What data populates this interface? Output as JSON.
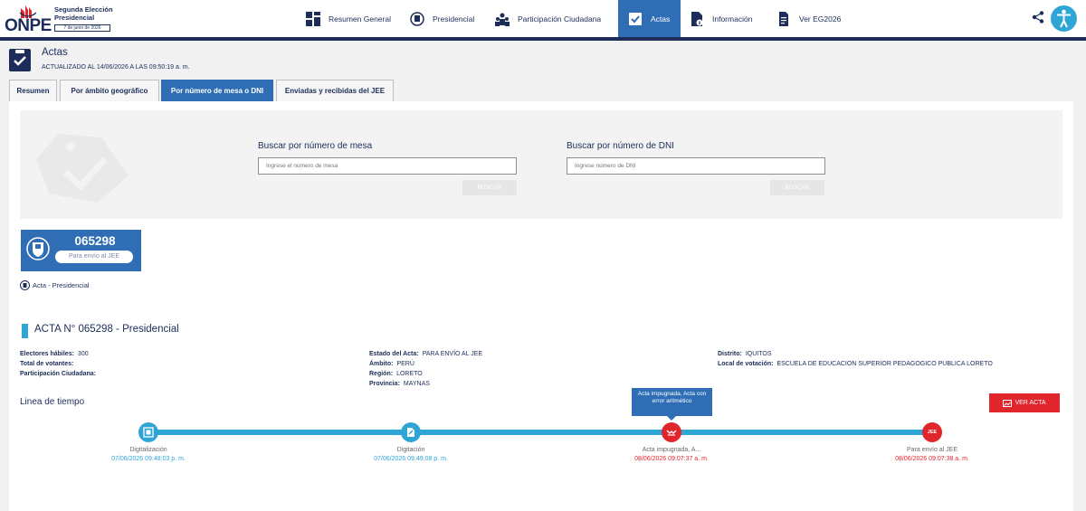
{
  "header_brand": {
    "logo_text": "ONPE",
    "title": "Segunda Elección Presidencial",
    "date": "7 de junio de 2026"
  },
  "nav": [
    {
      "label": "Resumen General",
      "icon": "grid-icon"
    },
    {
      "label": "Presidencial",
      "icon": "seal-icon"
    },
    {
      "label": "Participación Ciudadana",
      "icon": "people-icon"
    },
    {
      "label": "Actas",
      "icon": "acta-check-icon",
      "active": true
    },
    {
      "label": "Información",
      "icon": "document-info-icon"
    },
    {
      "label": "Ver EG2026",
      "icon": "document-icon"
    }
  ],
  "page": {
    "title": "Actas",
    "updated": "ACTUALIZADO AL 14/06/2026 A LAS 09:50:19 a. m."
  },
  "tabs": [
    {
      "label": "Resumen"
    },
    {
      "label": "Por ámbito geográfico"
    },
    {
      "label": "Por número de mesa o DNI",
      "active": true
    },
    {
      "label": "Enviadas y recibidas del JEE"
    }
  ],
  "search": {
    "mesa_label": "Buscar por número de mesa",
    "mesa_placeholder": "Ingrese el número de mesa",
    "mesa_button": "BUSCAR",
    "dni_label": "Buscar por número de DNI",
    "dni_placeholder": "Ingrese número de DNI",
    "dni_button": "BUSCAR"
  },
  "mesa": {
    "number": "065298",
    "status": "Para envío al JEE",
    "link": "Acta - Presidencial"
  },
  "detail": {
    "title": "ACTA N° 065298 - Presidencial",
    "electores_label": "Electores hábiles:",
    "electores_value": "300",
    "votantes_label": "Total de votantes:",
    "participacion_label": "Participación Ciudadana:",
    "estado_label": "Estado del Acta:",
    "estado_value": "PARA ENVÍO AL JEE",
    "ambito_label": "Ámbito:",
    "ambito_value": "PERÚ",
    "region_label": "Región:",
    "region_value": "LORETO",
    "provincia_label": "Provincia:",
    "provincia_value": "MAYNAS",
    "distrito_label": "Distrito:",
    "distrito_value": "IQUITOS",
    "local_label": "Local de votación:",
    "local_value": "ESCUELA DE EDUCACION SUPERIOR PEDAGOGICO PUBLICA LORETO"
  },
  "timeline": {
    "title": "Linea de tiempo",
    "view_button": "VER ACTA",
    "tooltip": "Acta impugnada, Acta con error aritmético",
    "steps": [
      {
        "name": "Digitalización",
        "date": "07/06/2026 09:48:03 p. m.",
        "status": "done",
        "color": "#2fa5d6"
      },
      {
        "name": "Digitación",
        "date": "07/06/2026 09:49:08 p. m.",
        "status": "done",
        "color": "#2fa5d6"
      },
      {
        "name": "Acta impugnada, A...",
        "date": "08/06/2026 09:07:37 a. m.",
        "status": "observed",
        "color": "#e0252d"
      },
      {
        "name": "Para envío al JEE",
        "date": "08/06/2026 09:07:38 a. m.",
        "status": "observed",
        "color": "#e0252d",
        "badge": "JEE"
      }
    ]
  },
  "colors": {
    "navy": "#1c2d5a",
    "accent_blue": "#2f6eb5",
    "cyan": "#2fa5d6",
    "red": "#e0252d"
  }
}
